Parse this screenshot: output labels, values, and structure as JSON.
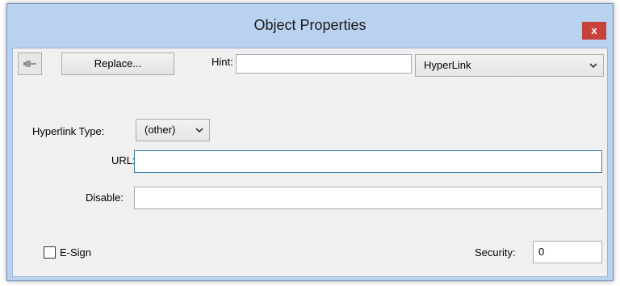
{
  "window": {
    "title": "Object Properties",
    "close_label": "x"
  },
  "toolbar": {
    "replace_label": "Replace...",
    "hint_label": "Hint:",
    "hint_value": "",
    "type_select_value": "HyperLink"
  },
  "form": {
    "hyperlink_type_label": "Hyperlink Type:",
    "hyperlink_type_value": "(other)",
    "url_label": "URL:",
    "url_value": "",
    "disable_label": "Disable:",
    "disable_value": "",
    "esign_label": "E-Sign",
    "esign_checked": false,
    "security_label": "Security:",
    "security_value": "0"
  },
  "icons": {
    "pin": "pushpin-icon",
    "chevron": "chevron-down-icon",
    "close": "close-icon"
  }
}
